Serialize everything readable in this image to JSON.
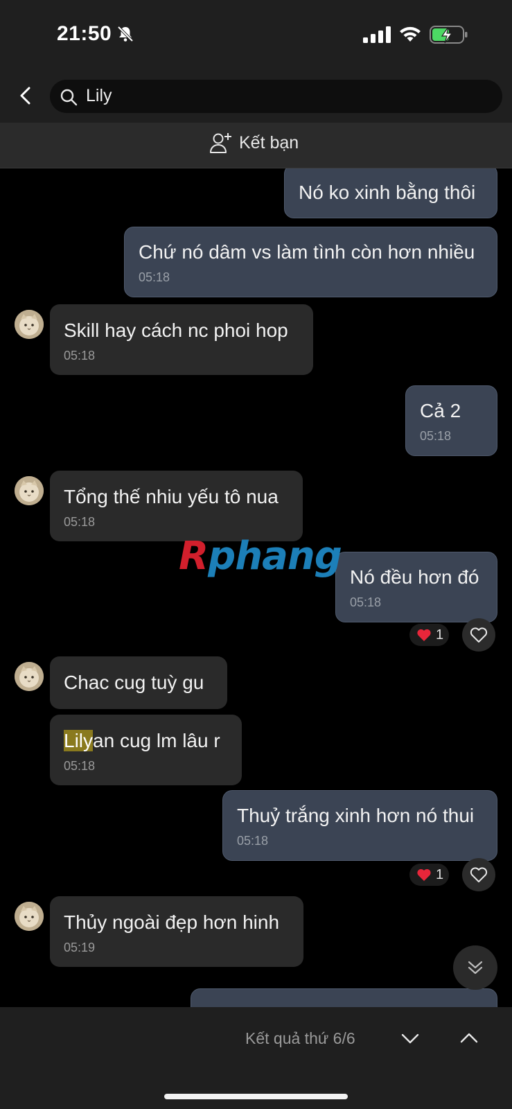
{
  "status_bar": {
    "time": "21:50"
  },
  "search": {
    "query": "Lily"
  },
  "friend_bar": {
    "label": "Kết bạn"
  },
  "messages": [
    {
      "dir": "out",
      "text": "Nó ko xinh bằng thôi"
    },
    {
      "dir": "out",
      "text": "Chứ nó dâm vs làm tình còn hơn nhiều",
      "time": "05:18"
    },
    {
      "dir": "in",
      "text": "Skill hay cách nc phoi hop",
      "time": "05:18"
    },
    {
      "dir": "out",
      "text": "Cả 2",
      "time": "05:18"
    },
    {
      "dir": "in",
      "text": "Tổng thế nhiu yếu tô nua",
      "time": "05:18"
    },
    {
      "dir": "out",
      "text": "Nó đều hơn đó",
      "time": "05:18",
      "reaction": {
        "emoji": "heart",
        "count": "1"
      }
    },
    {
      "dir": "in",
      "text": "Chac cug tuỳ gu"
    },
    {
      "dir": "in",
      "highlight": "Lily",
      "text": "an cug lm lâu r",
      "time": "05:18"
    },
    {
      "dir": "out",
      "text": "Thuỷ trắng xinh hơn nó thui",
      "time": "05:18",
      "reaction": {
        "emoji": "heart",
        "count": "1"
      }
    },
    {
      "dir": "in",
      "text": "Thủy ngoài đẹp hơn hinh",
      "time": "05:19"
    }
  ],
  "watermark": {
    "part1": "R",
    "part2": "phang"
  },
  "search_nav": {
    "result_label": "Kết quả thứ 6/6"
  },
  "colors": {
    "outgoing_bubble": "#3b4454",
    "incoming_bubble": "#2a2a2a",
    "highlight": "#8a7a1e",
    "background": "#000000"
  }
}
